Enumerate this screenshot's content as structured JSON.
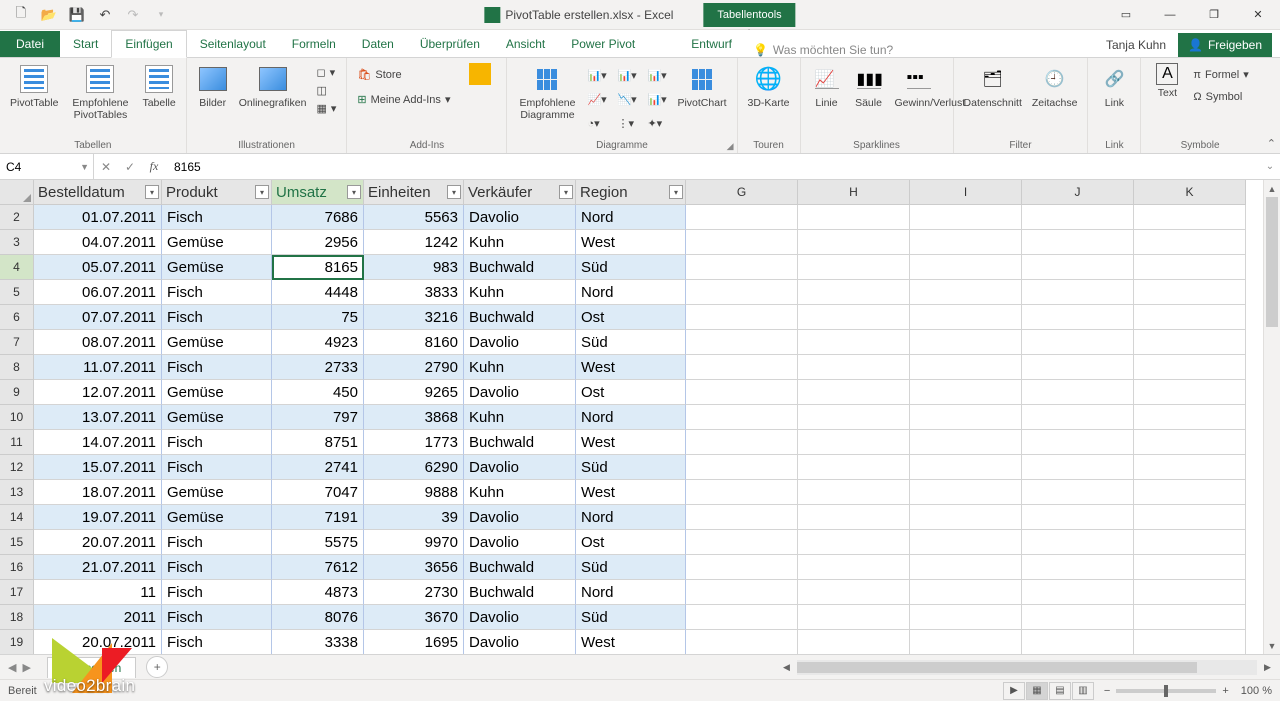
{
  "title": {
    "filename": "PivotTable erstellen.xlsx - Excel",
    "tools_tab": "Tabellentools"
  },
  "quick_access": {
    "undo": "↶",
    "redo": "↷"
  },
  "tabs": [
    "Datei",
    "Start",
    "Einfügen",
    "Seitenlayout",
    "Formeln",
    "Daten",
    "Überprüfen",
    "Ansicht",
    "Power Pivot",
    "Entwurf"
  ],
  "active_tab_index": 2,
  "tellme": {
    "placeholder": "Was möchten Sie tun?"
  },
  "user": {
    "name": "Tanja Kuhn",
    "share": "Freigeben"
  },
  "ribbon": {
    "groups": {
      "tabellen": {
        "label": "Tabellen",
        "items": [
          "PivotTable",
          "Empfohlene PivotTables",
          "Tabelle"
        ]
      },
      "illustrationen": {
        "label": "Illustrationen",
        "items": [
          "Bilder",
          "Onlinegrafiken"
        ]
      },
      "addins": {
        "label": "Add-Ins",
        "store": "Store",
        "myaddins": "Meine Add-Ins"
      },
      "diagramme": {
        "label": "Diagramme",
        "rec": "Empfohlene Diagramme",
        "pivotchart": "PivotChart"
      },
      "touren": {
        "label": "Touren",
        "item": "3D-Karte"
      },
      "sparklines": {
        "label": "Sparklines",
        "items": [
          "Linie",
          "Säule",
          "Gewinn/Verlust"
        ]
      },
      "filter": {
        "label": "Filter",
        "items": [
          "Datenschnitt",
          "Zeitachse"
        ]
      },
      "link": {
        "label": "Link",
        "item": "Link"
      },
      "symbole": {
        "label": "Symbole",
        "text": "Text",
        "formel": "Formel",
        "symbol": "Symbol"
      }
    }
  },
  "namebox": "C4",
  "formula": "8165",
  "columns": [
    "Bestelldatum",
    "Produkt",
    "Umsatz",
    "Einheiten",
    "Verkäufer",
    "Region"
  ],
  "plain_cols": [
    "G",
    "H",
    "I",
    "J",
    "K"
  ],
  "rows": [
    {
      "n": 2,
      "d": [
        "01.07.2011",
        "Fisch",
        "7686",
        "5563",
        "Davolio",
        "Nord"
      ]
    },
    {
      "n": 3,
      "d": [
        "04.07.2011",
        "Gemüse",
        "2956",
        "1242",
        "Kuhn",
        "West"
      ]
    },
    {
      "n": 4,
      "d": [
        "05.07.2011",
        "Gemüse",
        "8165",
        "983",
        "Buchwald",
        "Süd"
      ]
    },
    {
      "n": 5,
      "d": [
        "06.07.2011",
        "Fisch",
        "4448",
        "3833",
        "Kuhn",
        "Nord"
      ]
    },
    {
      "n": 6,
      "d": [
        "07.07.2011",
        "Fisch",
        "75",
        "3216",
        "Buchwald",
        "Ost"
      ]
    },
    {
      "n": 7,
      "d": [
        "08.07.2011",
        "Gemüse",
        "4923",
        "8160",
        "Davolio",
        "Süd"
      ]
    },
    {
      "n": 8,
      "d": [
        "11.07.2011",
        "Fisch",
        "2733",
        "2790",
        "Kuhn",
        "West"
      ]
    },
    {
      "n": 9,
      "d": [
        "12.07.2011",
        "Gemüse",
        "450",
        "9265",
        "Davolio",
        "Ost"
      ]
    },
    {
      "n": 10,
      "d": [
        "13.07.2011",
        "Gemüse",
        "797",
        "3868",
        "Kuhn",
        "Nord"
      ]
    },
    {
      "n": 11,
      "d": [
        "14.07.2011",
        "Fisch",
        "8751",
        "1773",
        "Buchwald",
        "West"
      ]
    },
    {
      "n": 12,
      "d": [
        "15.07.2011",
        "Fisch",
        "2741",
        "6290",
        "Davolio",
        "Süd"
      ]
    },
    {
      "n": 13,
      "d": [
        "18.07.2011",
        "Gemüse",
        "7047",
        "9888",
        "Kuhn",
        "West"
      ]
    },
    {
      "n": 14,
      "d": [
        "19.07.2011",
        "Gemüse",
        "7191",
        "39",
        "Davolio",
        "Nord"
      ]
    },
    {
      "n": 15,
      "d": [
        "20.07.2011",
        "Fisch",
        "5575",
        "9970",
        "Davolio",
        "Ost"
      ]
    },
    {
      "n": 16,
      "d": [
        "21.07.2011",
        "Fisch",
        "7612",
        "3656",
        "Buchwald",
        "Süd"
      ]
    },
    {
      "n": 17,
      "d": [
        "11",
        "Fisch",
        "4873",
        "2730",
        "Buchwald",
        "Nord"
      ]
    },
    {
      "n": 18,
      "d": [
        "2011",
        "Fisch",
        "8076",
        "3670",
        "Davolio",
        "Süd"
      ]
    },
    {
      "n": 19,
      "d": [
        "20.07.2011",
        "Fisch",
        "3338",
        "1695",
        "Davolio",
        "West"
      ]
    }
  ],
  "selected": {
    "row": 4,
    "col": 2
  },
  "sheet_tab": "Basisdaten",
  "status": {
    "ready": "Bereit",
    "zoom": "100 %"
  },
  "watermark": "video2brain"
}
